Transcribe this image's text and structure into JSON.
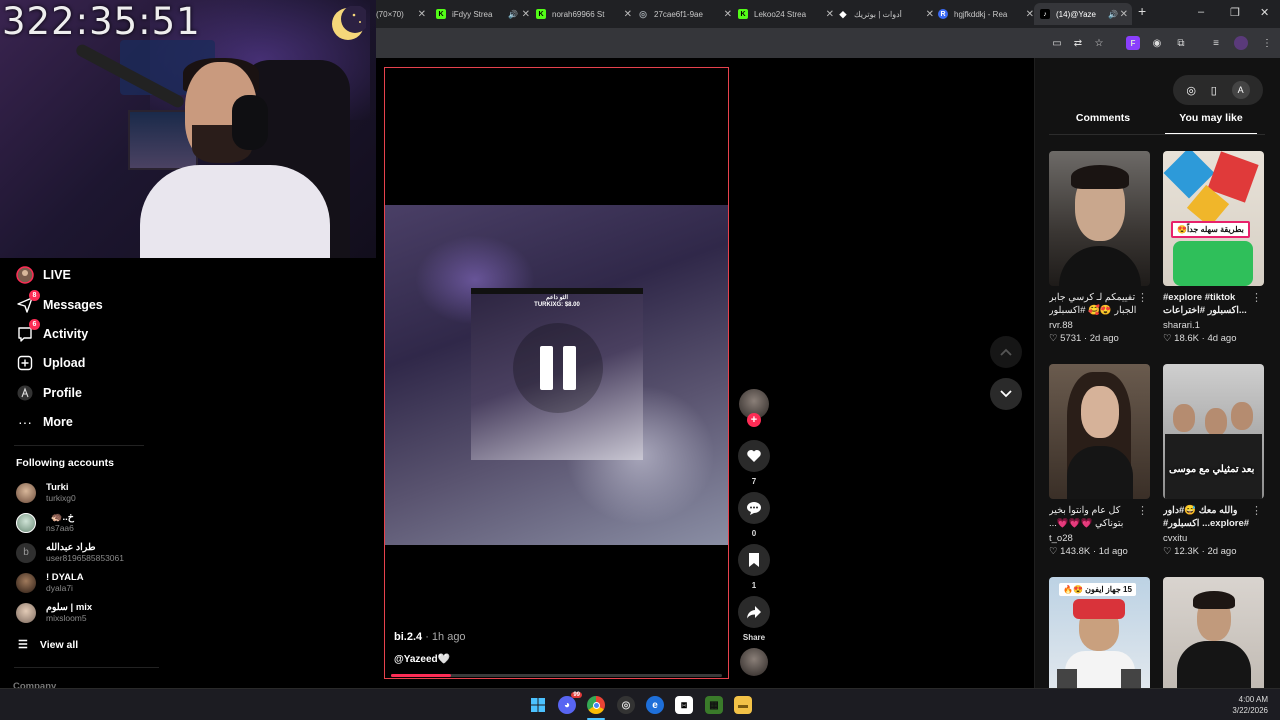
{
  "stream": {
    "timer": "322:35:51"
  },
  "sidebar": {
    "nav": [
      {
        "label": "LIVE",
        "icon": "live-avatar-icon"
      },
      {
        "label": "Messages",
        "icon": "paper-plane-icon",
        "badge": "8"
      },
      {
        "label": "Activity",
        "icon": "inbox-icon",
        "badge": "6"
      },
      {
        "label": "Upload",
        "icon": "plus-square-icon"
      },
      {
        "label": "Profile",
        "icon": "profile-avatar-icon"
      },
      {
        "label": "More",
        "icon": "more-dots-icon"
      }
    ],
    "following_title": "Following accounts",
    "following": [
      {
        "name": "Turki",
        "user": "turkixg0"
      },
      {
        "name": "خ..🦔",
        "user": "ns7aa6"
      },
      {
        "name": "طراد عبدالله",
        "user": "user8196585853061"
      },
      {
        "name": "! DYALA",
        "user": "dyala7i"
      },
      {
        "name": "سلوم | mix",
        "user": "mixsloom5"
      }
    ],
    "view_all": "View all",
    "company": "Company"
  },
  "browser": {
    "tabs": [
      {
        "title": "(70×70)",
        "fav": "",
        "fav_color": "#202124"
      },
      {
        "title": "iFdyy Strea",
        "fav": "K",
        "fav_color": "#53fc18",
        "audio": true
      },
      {
        "title": "norah69966 St",
        "fav": "K",
        "fav_color": "#53fc18"
      },
      {
        "title": "27cae6f1-9ae",
        "fav": "◎",
        "fav_color": "#9aa0a6"
      },
      {
        "title": "Lekoo24 Strea",
        "fav": "K",
        "fav_color": "#53fc18"
      },
      {
        "title": "أدوات | بوتريك",
        "fav": "◆",
        "fav_color": "#ffffff"
      },
      {
        "title": "hgjfkddkj - Rea",
        "fav": "R",
        "fav_color": "#3b6bf5"
      },
      {
        "title": "(14)@Yaze",
        "fav": "♪",
        "fav_color": "#000000",
        "audio": true,
        "active": true
      }
    ],
    "new_tab": "+",
    "window_controls": [
      "–",
      "❐",
      "✕"
    ]
  },
  "video": {
    "overlay_title": "الثو داعم",
    "overlay_line": "TURKIXG: $8.00",
    "author": "bi.2.4",
    "time_ago": "· 1h ago",
    "caption": "@Yazeed🤍",
    "progress_fraction": 0.18,
    "actions": {
      "likes": "7",
      "comments": "0",
      "saves": "1",
      "share_label": "Share"
    }
  },
  "right_panel": {
    "tab_comments": "Comments",
    "tab_you_may_like": "You may like",
    "cards": [
      {
        "title": "تفييمكم لـ كرسي جابر الجبار 😍🥰 #اكسبلور",
        "user": "rvr.88",
        "likes": "5731",
        "ago": "2d ago",
        "rtl": true
      },
      {
        "title": "#explore #tiktok اكسبلور #اختراعات...",
        "user": "sharari.1",
        "likes": "18.6K",
        "ago": "4d ago",
        "rtl": false,
        "overlay": "بطريقة سهله جداً😍"
      },
      {
        "title": "كل عام وانتوا بخير بتوناكي 💗💗💗...",
        "user": "t_o28",
        "likes": "143.8K",
        "ago": "1d ago",
        "rtl": true
      },
      {
        "title": "والله معك 😅#داور #explore... اكسبلور#",
        "user": "cvxitu",
        "likes": "12.3K",
        "ago": "2d ago",
        "rtl": false,
        "overlay": "بعد تمثيلي مع موسى"
      },
      {
        "title": "",
        "user": "",
        "likes": "",
        "ago": "",
        "overlay": "15 جهاز ايفون 😍🔥"
      },
      {
        "title": "",
        "user": "",
        "likes": "",
        "ago": ""
      }
    ]
  },
  "taskbar": {
    "time": "4:00 AM",
    "date": "3/22/2026",
    "discord_badge": "99"
  }
}
